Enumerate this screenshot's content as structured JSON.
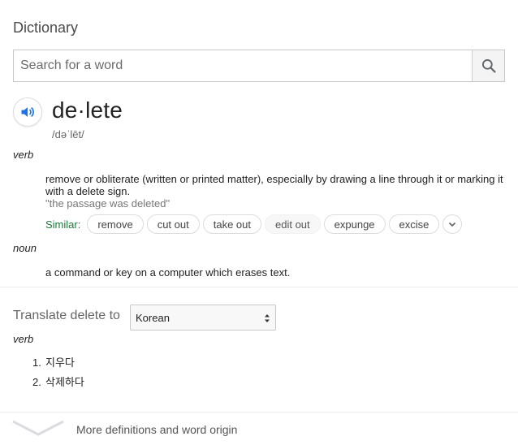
{
  "header": {
    "title": "Dictionary"
  },
  "search": {
    "placeholder": "Search for a word",
    "value": ""
  },
  "entry": {
    "word": "de·lete",
    "phonetic": "/dəˈlēt/",
    "senses": [
      {
        "pos": "verb",
        "definition": "remove or obliterate (written or printed matter), especially by drawing a line through it or marking it with a delete sign.",
        "example": "\"the passage was deleted\"",
        "similar_label": "Similar:",
        "similar": [
          "remove",
          "cut out",
          "take out",
          "edit out",
          "expunge",
          "excise"
        ]
      },
      {
        "pos": "noun",
        "definition": "a command or key on a computer which erases text."
      }
    ]
  },
  "translate": {
    "label": "Translate delete to",
    "selected_language": "Korean",
    "pos": "verb",
    "items": [
      {
        "num": "1.",
        "text": "지우다"
      },
      {
        "num": "2.",
        "text": "삭제하다"
      }
    ]
  },
  "footer": {
    "more_label": "More definitions and word origin"
  },
  "colors": {
    "speaker": "#1a73e8",
    "similar_label": "#1a7a3a"
  }
}
